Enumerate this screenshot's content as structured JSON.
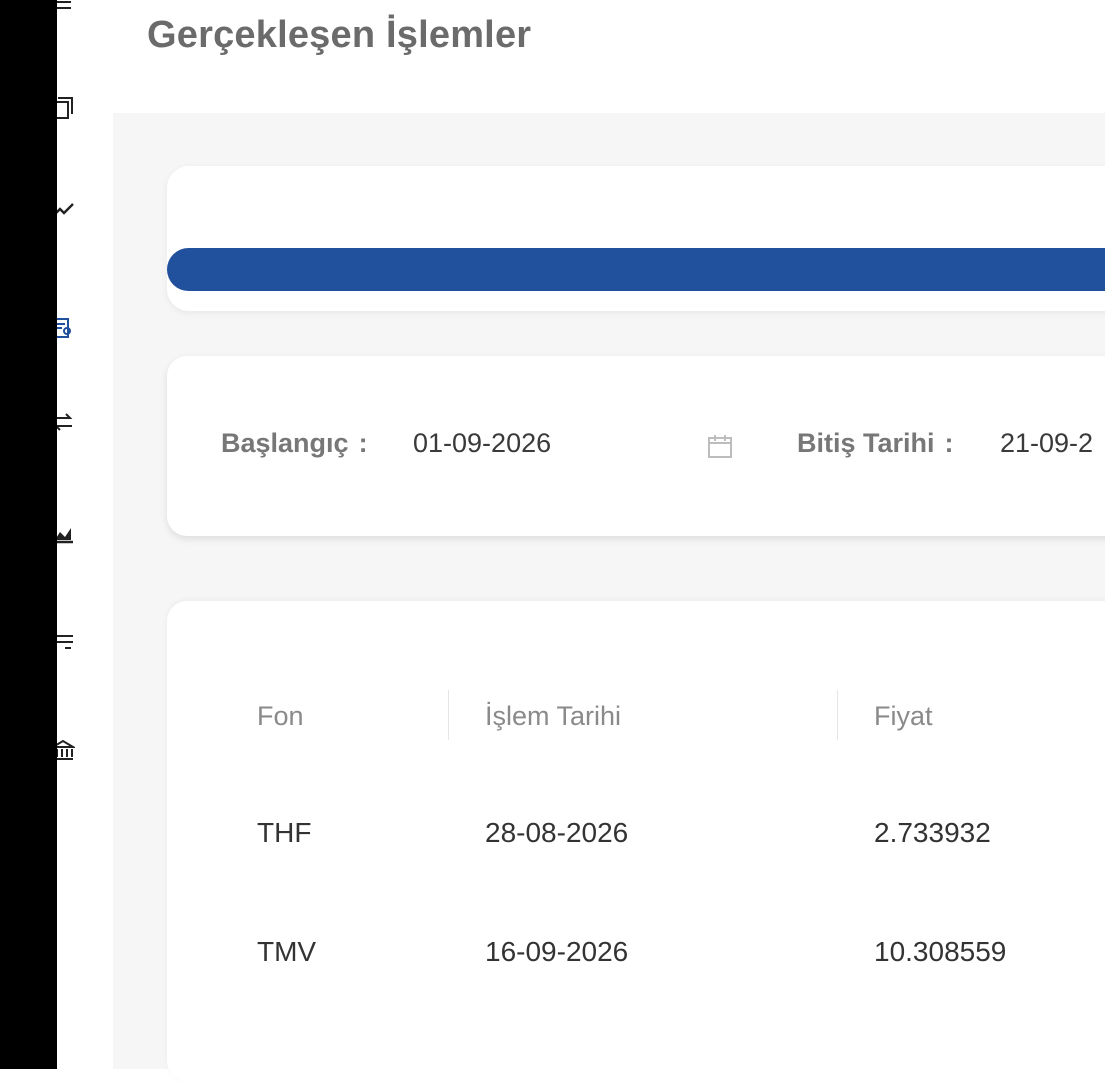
{
  "page": {
    "title": "Gerçekleşen İşlemler"
  },
  "sidebar": {
    "icons": [
      "menu-icon",
      "copy-icon",
      "trend-icon",
      "user-list-icon",
      "transfer-icon",
      "chart-icon",
      "filter-icon",
      "bank-icon"
    ],
    "active_icon": "user-list-icon",
    "accent": "#21509c"
  },
  "progress": {
    "color": "#21509c"
  },
  "filter": {
    "start_label": "Başlangıç",
    "start_value": "01-09-2026",
    "end_label": "Bitiş Tarihi",
    "end_value": "21-09-2",
    "separator": ":"
  },
  "table": {
    "headers": [
      "Fon",
      "İşlem Tarihi",
      "Fiyat"
    ],
    "rows": [
      {
        "fon": "THF",
        "tarih": "28-08-2026",
        "fiyat": "2.733932"
      },
      {
        "fon": "TMV",
        "tarih": "16-09-2026",
        "fiyat": "10.308559"
      }
    ]
  }
}
